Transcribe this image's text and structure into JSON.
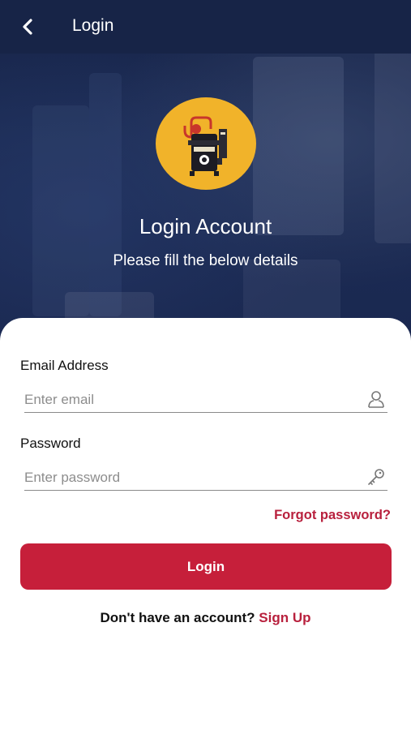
{
  "topbar": {
    "title": "Login",
    "back_icon": "chevron-left-icon"
  },
  "hero": {
    "logo_icon": "distillery-still-logo",
    "title": "Login Account",
    "subtitle": "Please fill the below details"
  },
  "form": {
    "email": {
      "label": "Email Address",
      "placeholder": "Enter email",
      "value": "",
      "icon": "user-icon"
    },
    "password": {
      "label": "Password",
      "placeholder": "Enter password",
      "value": "",
      "icon": "key-icon"
    },
    "forgot_label": "Forgot password?",
    "login_label": "Login"
  },
  "footer": {
    "prompt": "Don't have an account?",
    "signup_label": "Sign Up"
  },
  "colors": {
    "header_bg": "#172447",
    "logo_bg": "#f1b32a",
    "accent": "#c61f3a",
    "link": "#b8203d"
  }
}
